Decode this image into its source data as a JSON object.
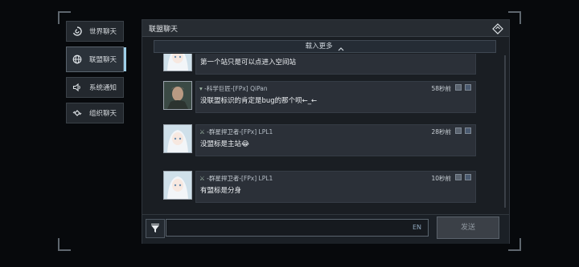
{
  "sidebar": {
    "items": [
      {
        "label": "世界聊天",
        "icon": "world-swirl-icon"
      },
      {
        "label": "联盟聊天",
        "icon": "globe-icon",
        "active": true
      },
      {
        "label": "系统通知",
        "icon": "speaker-icon"
      },
      {
        "label": "组织聊天",
        "icon": "link-icon"
      }
    ]
  },
  "panel": {
    "title": "联盟聊天",
    "header_icon": "diamond-icon",
    "load_more": "载入更多",
    "load_more_icon": "chevron-up-icon"
  },
  "messages": [
    {
      "tag": "",
      "guild": "",
      "name": "",
      "time": "",
      "text": "第一个站只是可以点进入空间站",
      "avatar": "white-hair-girl"
    },
    {
      "tag": "▾",
      "guild": "-科学巨匠-",
      "name": "[FPx] QiPan",
      "time": "58秒前",
      "text": "没联盟标识的肯定是bug的那个呗←_←",
      "avatar": "armored-man"
    },
    {
      "tag": "⚔",
      "guild": "-群星捍卫者-",
      "name": "[FPx] LPL1",
      "time": "28秒前",
      "text": "没盟标是主站😂",
      "avatar": "white-hair-girl"
    },
    {
      "tag": "⚔",
      "guild": "-群星捍卫者-",
      "name": "[FPx] LPL1",
      "time": "10秒前",
      "text": "有盟标是分身",
      "avatar": "white-hair-girl"
    }
  ],
  "input": {
    "placeholder": "",
    "lang": "EN",
    "send_label": "发送",
    "filter_icon": "filter-funnel-icon"
  },
  "colors": {
    "accent": "#9ecfe8",
    "panel_bg": "#1a1e23",
    "bubble_bg": "#2b3038"
  }
}
